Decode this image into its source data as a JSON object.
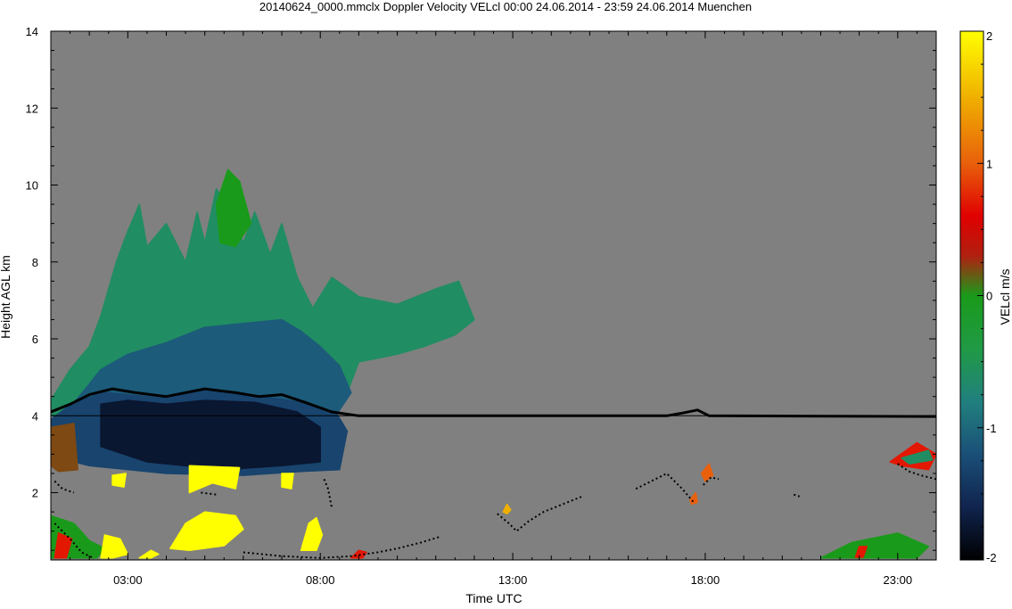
{
  "chart_data": {
    "type": "heatmap",
    "title": "20140624_0000.mmclx Doppler Velocity VELcl   00:00 24.06.2014 - 23:59 24.06.2014 Muenchen",
    "xlabel": "Time UTC",
    "ylabel": "Height AGL km",
    "xlim_hours": [
      1.0,
      24.0
    ],
    "ylim_km": [
      0.25,
      14.0
    ],
    "x_ticks": [
      {
        "hour": 3,
        "label": "03:00"
      },
      {
        "hour": 8,
        "label": "08:00"
      },
      {
        "hour": 13,
        "label": "13:00"
      },
      {
        "hour": 18,
        "label": "18:00"
      },
      {
        "hour": 23,
        "label": "23:00"
      }
    ],
    "y_ticks": [
      {
        "km": 2,
        "label": "2"
      },
      {
        "km": 4,
        "label": "4"
      },
      {
        "km": 6,
        "label": "6"
      },
      {
        "km": 8,
        "label": "8"
      },
      {
        "km": 10,
        "label": "10"
      },
      {
        "km": 12,
        "label": "12"
      },
      {
        "km": 14,
        "label": "14"
      }
    ],
    "background_color": "#808080",
    "colorbar": {
      "label": "VELcl m/s",
      "min": -2,
      "max": 2,
      "ticks": [
        {
          "value": 2,
          "label": "2"
        },
        {
          "value": 1,
          "label": "1"
        },
        {
          "value": 0,
          "label": "0"
        },
        {
          "value": -1,
          "label": "-1"
        },
        {
          "value": -2,
          "label": "-2"
        }
      ],
      "stops": [
        {
          "value": -2.0,
          "color": "#000000"
        },
        {
          "value": -1.6,
          "color": "#10244e"
        },
        {
          "value": -1.2,
          "color": "#1a4f78"
        },
        {
          "value": -0.8,
          "color": "#21807e"
        },
        {
          "value": -0.4,
          "color": "#209a45"
        },
        {
          "value": 0.0,
          "color": "#1a9a1a"
        },
        {
          "value": 0.3,
          "color": "#b02010"
        },
        {
          "value": 0.6,
          "color": "#e00000"
        },
        {
          "value": 1.0,
          "color": "#e8600c"
        },
        {
          "value": 1.5,
          "color": "#f0b000"
        },
        {
          "value": 2.0,
          "color": "#ffff00"
        }
      ]
    },
    "reference_height_km": 4.0,
    "melting_layer_km": [
      {
        "x": 1.0,
        "y": 4.1
      },
      {
        "x": 1.5,
        "y": 4.3
      },
      {
        "x": 2.0,
        "y": 4.55
      },
      {
        "x": 2.6,
        "y": 4.7
      },
      {
        "x": 3.2,
        "y": 4.6
      },
      {
        "x": 4.0,
        "y": 4.5
      },
      {
        "x": 5.0,
        "y": 4.7
      },
      {
        "x": 5.8,
        "y": 4.6
      },
      {
        "x": 6.4,
        "y": 4.5
      },
      {
        "x": 7.0,
        "y": 4.55
      },
      {
        "x": 7.6,
        "y": 4.35
      },
      {
        "x": 8.3,
        "y": 4.1
      },
      {
        "x": 9.0,
        "y": 4.0
      },
      {
        "x": 12.0,
        "y": 4.0
      },
      {
        "x": 17.0,
        "y": 4.0
      },
      {
        "x": 17.4,
        "y": 4.07
      },
      {
        "x": 17.8,
        "y": 4.15
      },
      {
        "x": 18.1,
        "y": 4.0
      },
      {
        "x": 24.0,
        "y": 3.98
      }
    ],
    "regions": [
      {
        "v": -0.6,
        "pts": [
          [
            1.0,
            4.4
          ],
          [
            1.5,
            5.2
          ],
          [
            2.0,
            5.8
          ],
          [
            2.3,
            6.6
          ],
          [
            2.7,
            8.0
          ],
          [
            3.0,
            8.8
          ],
          [
            3.3,
            9.5
          ],
          [
            3.5,
            8.4
          ],
          [
            4.0,
            9.0
          ],
          [
            4.5,
            8.0
          ],
          [
            4.8,
            9.3
          ],
          [
            5.0,
            8.5
          ],
          [
            5.3,
            9.9
          ],
          [
            5.6,
            9.5
          ],
          [
            6.0,
            8.5
          ],
          [
            6.3,
            9.3
          ],
          [
            6.7,
            8.2
          ],
          [
            7.0,
            9.0
          ],
          [
            7.4,
            7.6
          ],
          [
            7.8,
            6.8
          ],
          [
            8.3,
            7.6
          ],
          [
            9.0,
            7.1
          ],
          [
            10.0,
            6.9
          ],
          [
            11.0,
            7.3
          ],
          [
            11.6,
            7.5
          ],
          [
            12.0,
            6.5
          ],
          [
            11.5,
            6.1
          ],
          [
            10.7,
            5.8
          ],
          [
            10.0,
            5.6
          ],
          [
            9.5,
            5.5
          ],
          [
            9.0,
            5.4
          ],
          [
            8.7,
            4.6
          ],
          [
            8.3,
            4.0
          ],
          [
            7.0,
            3.9
          ],
          [
            5.0,
            3.9
          ],
          [
            3.0,
            4.0
          ],
          [
            1.0,
            4.0
          ]
        ]
      },
      {
        "v": 0.0,
        "pts": [
          [
            5.3,
            9.5
          ],
          [
            5.6,
            10.4
          ],
          [
            5.9,
            10.1
          ],
          [
            6.2,
            9.0
          ],
          [
            5.8,
            8.4
          ],
          [
            5.4,
            8.5
          ]
        ]
      },
      {
        "v": -1.1,
        "pts": [
          [
            1.4,
            4.1
          ],
          [
            1.9,
            4.7
          ],
          [
            2.3,
            5.2
          ],
          [
            3.0,
            5.6
          ],
          [
            4.0,
            5.9
          ],
          [
            5.0,
            6.3
          ],
          [
            6.0,
            6.4
          ],
          [
            7.0,
            6.5
          ],
          [
            7.5,
            6.2
          ],
          [
            8.0,
            5.8
          ],
          [
            8.5,
            5.3
          ],
          [
            8.8,
            4.6
          ],
          [
            8.4,
            4.0
          ],
          [
            6.0,
            3.9
          ],
          [
            3.0,
            3.95
          ],
          [
            1.5,
            4.0
          ]
        ]
      },
      {
        "v": -1.3,
        "pts": [
          [
            1.0,
            3.9
          ],
          [
            1.6,
            4.35
          ],
          [
            2.4,
            4.6
          ],
          [
            4.0,
            4.45
          ],
          [
            5.0,
            4.65
          ],
          [
            6.5,
            4.5
          ],
          [
            7.5,
            4.35
          ],
          [
            8.4,
            4.1
          ],
          [
            8.7,
            3.6
          ],
          [
            8.5,
            2.6
          ],
          [
            7.5,
            2.55
          ],
          [
            6.0,
            2.45
          ],
          [
            4.0,
            2.5
          ],
          [
            2.0,
            2.7
          ],
          [
            1.0,
            2.95
          ]
        ]
      },
      {
        "v": -1.75,
        "pts": [
          [
            2.3,
            4.3
          ],
          [
            3.0,
            4.4
          ],
          [
            4.0,
            4.3
          ],
          [
            5.0,
            4.4
          ],
          [
            6.3,
            4.35
          ],
          [
            7.4,
            4.1
          ],
          [
            8.0,
            3.7
          ],
          [
            8.0,
            2.8
          ],
          [
            7.0,
            2.7
          ],
          [
            5.5,
            2.6
          ],
          [
            3.5,
            2.8
          ],
          [
            2.3,
            3.2
          ]
        ]
      },
      {
        "v": 0.2,
        "pts": [
          [
            1.0,
            3.7
          ],
          [
            1.6,
            3.8
          ],
          [
            1.7,
            2.6
          ],
          [
            1.2,
            2.55
          ],
          [
            1.0,
            2.7
          ]
        ]
      },
      {
        "v": 2.0,
        "pts": [
          [
            2.6,
            2.45
          ],
          [
            2.95,
            2.5
          ],
          [
            2.9,
            2.15
          ],
          [
            2.6,
            2.2
          ]
        ]
      },
      {
        "v": 2.0,
        "pts": [
          [
            4.6,
            2.7
          ],
          [
            5.9,
            2.65
          ],
          [
            5.8,
            2.1
          ],
          [
            5.2,
            2.25
          ],
          [
            4.6,
            2.0
          ]
        ]
      },
      {
        "v": 2.0,
        "pts": [
          [
            7.0,
            2.5
          ],
          [
            7.3,
            2.5
          ],
          [
            7.25,
            2.1
          ],
          [
            7.0,
            2.15
          ]
        ]
      },
      {
        "v": 2.0,
        "pts": [
          [
            4.1,
            0.55
          ],
          [
            4.5,
            1.2
          ],
          [
            5.0,
            1.5
          ],
          [
            5.8,
            1.4
          ],
          [
            6.0,
            1.05
          ],
          [
            5.5,
            0.62
          ],
          [
            4.6,
            0.5
          ]
        ]
      },
      {
        "v": 2.0,
        "pts": [
          [
            7.5,
            0.5
          ],
          [
            7.7,
            1.2
          ],
          [
            7.9,
            1.35
          ],
          [
            8.05,
            0.9
          ],
          [
            7.9,
            0.5
          ]
        ]
      },
      {
        "v": 2.0,
        "pts": [
          [
            3.3,
            0.3
          ],
          [
            3.6,
            0.5
          ],
          [
            3.8,
            0.4
          ],
          [
            3.6,
            0.3
          ]
        ]
      },
      {
        "v": 0.0,
        "pts": [
          [
            1.0,
            0.3
          ],
          [
            1.0,
            1.4
          ],
          [
            1.6,
            1.2
          ],
          [
            2.0,
            0.75
          ],
          [
            2.4,
            0.55
          ],
          [
            2.2,
            0.3
          ]
        ]
      },
      {
        "v": 0.7,
        "pts": [
          [
            1.1,
            0.3
          ],
          [
            1.2,
            0.95
          ],
          [
            1.55,
            0.8
          ],
          [
            1.4,
            0.3
          ]
        ]
      },
      {
        "v": 2.0,
        "pts": [
          [
            2.3,
            0.3
          ],
          [
            2.4,
            0.9
          ],
          [
            2.8,
            0.8
          ],
          [
            3.0,
            0.4
          ],
          [
            2.6,
            0.3
          ]
        ]
      },
      {
        "v": 0.0,
        "pts": [
          [
            21.0,
            0.3
          ],
          [
            21.8,
            0.7
          ],
          [
            23.0,
            0.95
          ],
          [
            23.8,
            0.6
          ],
          [
            23.5,
            0.3
          ]
        ]
      },
      {
        "v": 0.7,
        "pts": [
          [
            21.9,
            0.32
          ],
          [
            22.0,
            0.6
          ],
          [
            22.2,
            0.6
          ],
          [
            22.1,
            0.32
          ]
        ]
      },
      {
        "v": 0.7,
        "pts": [
          [
            22.8,
            2.8
          ],
          [
            23.5,
            3.3
          ],
          [
            24.0,
            3.0
          ],
          [
            23.8,
            2.6
          ],
          [
            23.1,
            2.7
          ]
        ]
      },
      {
        "v": -0.6,
        "pts": [
          [
            23.1,
            2.9
          ],
          [
            23.8,
            3.1
          ],
          [
            23.9,
            2.85
          ],
          [
            23.3,
            2.75
          ]
        ]
      },
      {
        "v": 1.0,
        "pts": [
          [
            17.9,
            2.5
          ],
          [
            18.1,
            2.75
          ],
          [
            18.2,
            2.45
          ],
          [
            18.0,
            2.3
          ]
        ]
      },
      {
        "v": 1.0,
        "pts": [
          [
            17.6,
            1.8
          ],
          [
            17.75,
            2.0
          ],
          [
            17.8,
            1.75
          ],
          [
            17.65,
            1.7
          ]
        ]
      },
      {
        "v": 1.5,
        "pts": [
          [
            12.75,
            1.5
          ],
          [
            12.85,
            1.7
          ],
          [
            12.95,
            1.55
          ],
          [
            12.85,
            1.45
          ]
        ]
      },
      {
        "v": 0.7,
        "pts": [
          [
            8.8,
            0.3
          ],
          [
            9.0,
            0.5
          ],
          [
            9.2,
            0.45
          ],
          [
            9.1,
            0.3
          ]
        ]
      }
    ],
    "echo_traces": [
      [
        [
          1.1,
          1.2
        ],
        [
          1.5,
          0.8
        ],
        [
          1.8,
          0.45
        ],
        [
          2.1,
          0.3
        ]
      ],
      [
        [
          6.0,
          0.45
        ],
        [
          7.0,
          0.35
        ],
        [
          8.0,
          0.3
        ],
        [
          8.8,
          0.35
        ],
        [
          9.5,
          0.45
        ],
        [
          10.0,
          0.55
        ],
        [
          10.6,
          0.7
        ],
        [
          11.1,
          0.85
        ]
      ],
      [
        [
          12.6,
          1.45
        ],
        [
          12.9,
          1.2
        ],
        [
          13.1,
          1.0
        ],
        [
          13.4,
          1.25
        ],
        [
          13.8,
          1.5
        ],
        [
          14.3,
          1.7
        ],
        [
          14.8,
          1.9
        ]
      ],
      [
        [
          16.2,
          2.1
        ],
        [
          16.6,
          2.3
        ],
        [
          17.0,
          2.5
        ],
        [
          17.4,
          2.1
        ],
        [
          17.7,
          1.75
        ]
      ],
      [
        [
          17.95,
          2.2
        ],
        [
          18.15,
          2.4
        ],
        [
          18.35,
          2.35
        ]
      ],
      [
        [
          20.3,
          1.95
        ],
        [
          20.45,
          1.9
        ]
      ],
      [
        [
          23.0,
          2.75
        ],
        [
          23.3,
          2.55
        ],
        [
          23.6,
          2.45
        ],
        [
          24.0,
          2.35
        ]
      ],
      [
        [
          1.1,
          2.3
        ],
        [
          1.3,
          2.1
        ],
        [
          1.6,
          2.0
        ]
      ],
      [
        [
          4.9,
          2.0
        ],
        [
          5.3,
          1.95
        ]
      ],
      [
        [
          8.1,
          2.35
        ],
        [
          8.2,
          2.1
        ],
        [
          8.3,
          1.6
        ]
      ]
    ]
  }
}
